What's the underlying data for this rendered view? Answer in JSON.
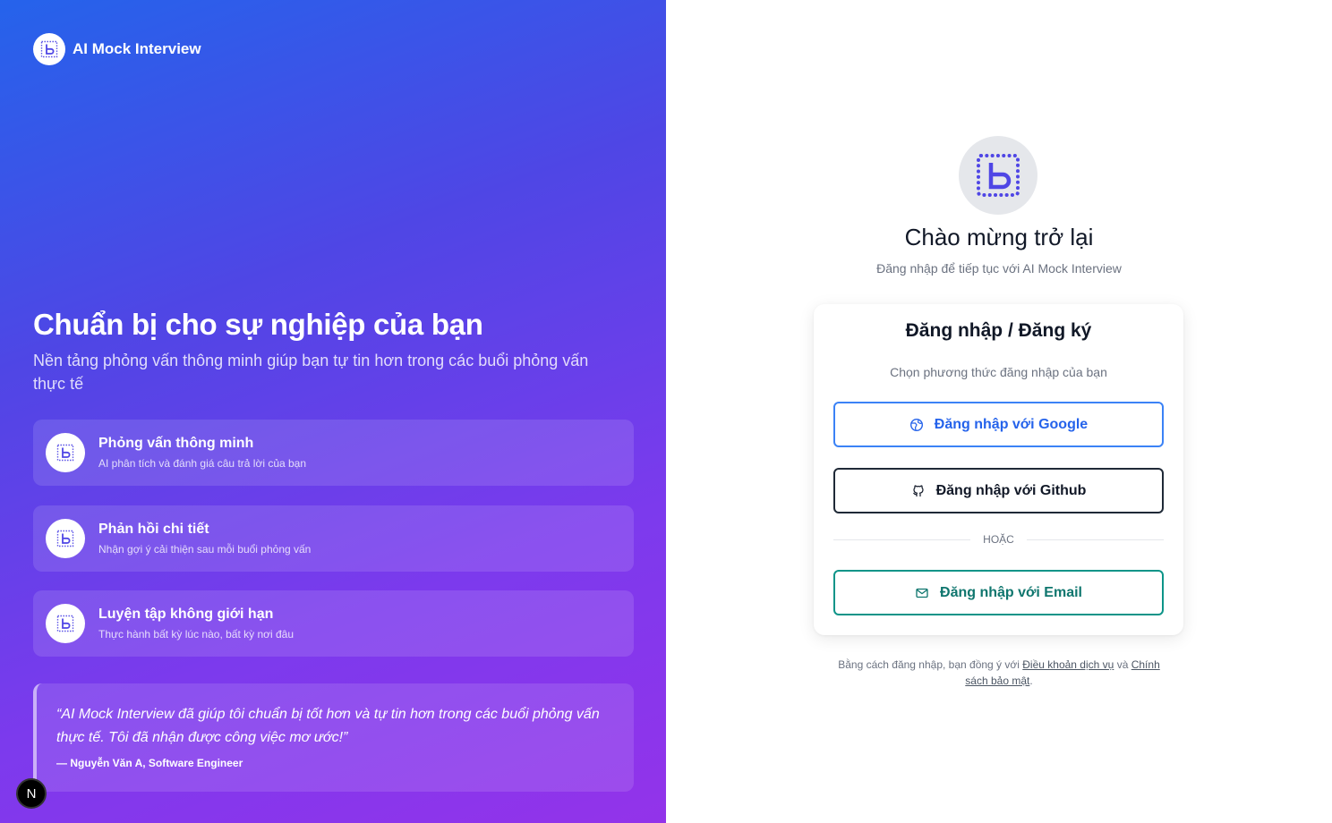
{
  "brand": {
    "name": "AI Mock Interview"
  },
  "hero": {
    "title": "Chuẩn bị cho sự nghiệp của bạn",
    "subtitle": "Nền tảng phỏng vấn thông minh giúp bạn tự tin hơn trong các buổi phỏng vấn thực tế"
  },
  "features": [
    {
      "title": "Phỏng vấn thông minh",
      "desc": "AI phân tích và đánh giá câu trả lời của bạn"
    },
    {
      "title": "Phản hồi chi tiết",
      "desc": "Nhận gợi ý cải thiện sau mỗi buổi phỏng vấn"
    },
    {
      "title": "Luyện tập không giới hạn",
      "desc": "Thực hành bất kỳ lúc nào, bất kỳ nơi đâu"
    }
  ],
  "testimonial": {
    "quote": "“AI Mock Interview đã giúp tôi chuẩn bị tốt hơn và tự tin hơn trong các buổi phỏng vấn thực tế. Tôi đã nhận được công việc mơ ước!”",
    "author": "— Nguyễn Văn A, Software Engineer"
  },
  "dev_badge": "N",
  "welcome": {
    "title": "Chào mừng trở lại",
    "subtitle": "Đăng nhập để tiếp tục với AI Mock Interview"
  },
  "login_card": {
    "title": "Đăng nhập / Đăng ký",
    "subtitle": "Chọn phương thức đăng nhập của bạn",
    "google_label": "Đăng nhập với Google",
    "github_label": "Đăng nhập với Github",
    "divider": "HOẶC",
    "email_label": "Đăng nhập với Email"
  },
  "legal": {
    "prefix": "Bằng cách đăng nhập, bạn đồng ý với",
    "terms": "Điều khoản dịch vụ",
    "and": "và",
    "privacy": "Chính sách bảo mật",
    "suffix": "."
  },
  "colors": {
    "gradient_start": "#2563eb",
    "gradient_end": "#9333ea",
    "google": "#3b82f6",
    "github": "#1f2937",
    "email": "#0d9488"
  },
  "icons": {
    "logo": "dotted-frame-b-icon",
    "google": "globe-icon",
    "github": "github-icon",
    "email": "mail-icon"
  }
}
